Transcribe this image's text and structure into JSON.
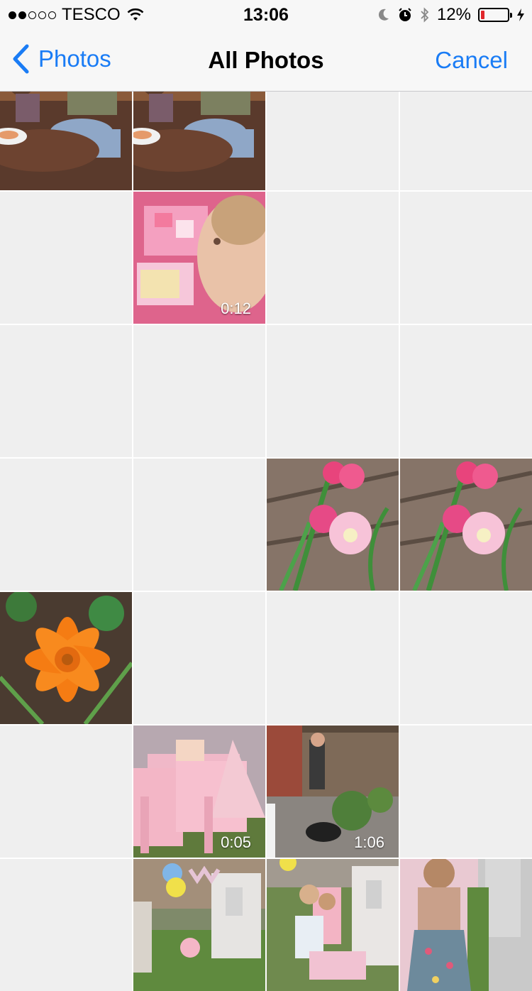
{
  "status_bar": {
    "carrier": "TESCO",
    "time": "13:06",
    "battery_percent": "12%",
    "battery_level": 0.12,
    "battery_color": "#e0262b",
    "signal_bars_filled": 2,
    "signal_bars_total": 5,
    "icons": [
      "wifi-icon",
      "moon-icon",
      "alarm-icon",
      "bluetooth-icon",
      "battery-icon",
      "charging-icon"
    ]
  },
  "nav": {
    "back_label": "Photos",
    "title": "All Photos",
    "cancel_label": "Cancel",
    "accent_color": "#1a7cf5"
  },
  "grid": {
    "columns": 4,
    "cells": [
      {
        "kind": "photo",
        "subject": "cafe-people",
        "duration": ""
      },
      {
        "kind": "photo",
        "subject": "cafe-people",
        "duration": ""
      },
      {
        "kind": "empty",
        "subject": "",
        "duration": ""
      },
      {
        "kind": "empty",
        "subject": "",
        "duration": ""
      },
      {
        "kind": "empty",
        "subject": "",
        "duration": ""
      },
      {
        "kind": "video",
        "subject": "child-toy",
        "duration": "0:12"
      },
      {
        "kind": "empty",
        "subject": "",
        "duration": ""
      },
      {
        "kind": "empty",
        "subject": "",
        "duration": ""
      },
      {
        "kind": "empty",
        "subject": "",
        "duration": ""
      },
      {
        "kind": "empty",
        "subject": "",
        "duration": ""
      },
      {
        "kind": "empty",
        "subject": "",
        "duration": ""
      },
      {
        "kind": "empty",
        "subject": "",
        "duration": ""
      },
      {
        "kind": "empty",
        "subject": "",
        "duration": ""
      },
      {
        "kind": "empty",
        "subject": "",
        "duration": ""
      },
      {
        "kind": "photo",
        "subject": "pink-gladiolus",
        "duration": ""
      },
      {
        "kind": "photo",
        "subject": "pink-gladiolus",
        "duration": ""
      },
      {
        "kind": "photo",
        "subject": "orange-flower",
        "duration": ""
      },
      {
        "kind": "empty",
        "subject": "",
        "duration": ""
      },
      {
        "kind": "empty",
        "subject": "",
        "duration": ""
      },
      {
        "kind": "empty",
        "subject": "",
        "duration": ""
      },
      {
        "kind": "empty",
        "subject": "",
        "duration": ""
      },
      {
        "kind": "video",
        "subject": "pink-party-table",
        "duration": "0:05"
      },
      {
        "kind": "video",
        "subject": "garden-dog",
        "duration": "1:06"
      },
      {
        "kind": "empty",
        "subject": "",
        "duration": ""
      },
      {
        "kind": "empty",
        "subject": "",
        "duration": ""
      },
      {
        "kind": "photo",
        "subject": "garden-party-balloons",
        "duration": ""
      },
      {
        "kind": "photo",
        "subject": "garden-playhouse-child",
        "duration": ""
      },
      {
        "kind": "photo",
        "subject": "child-floral-dress",
        "duration": ""
      }
    ]
  }
}
